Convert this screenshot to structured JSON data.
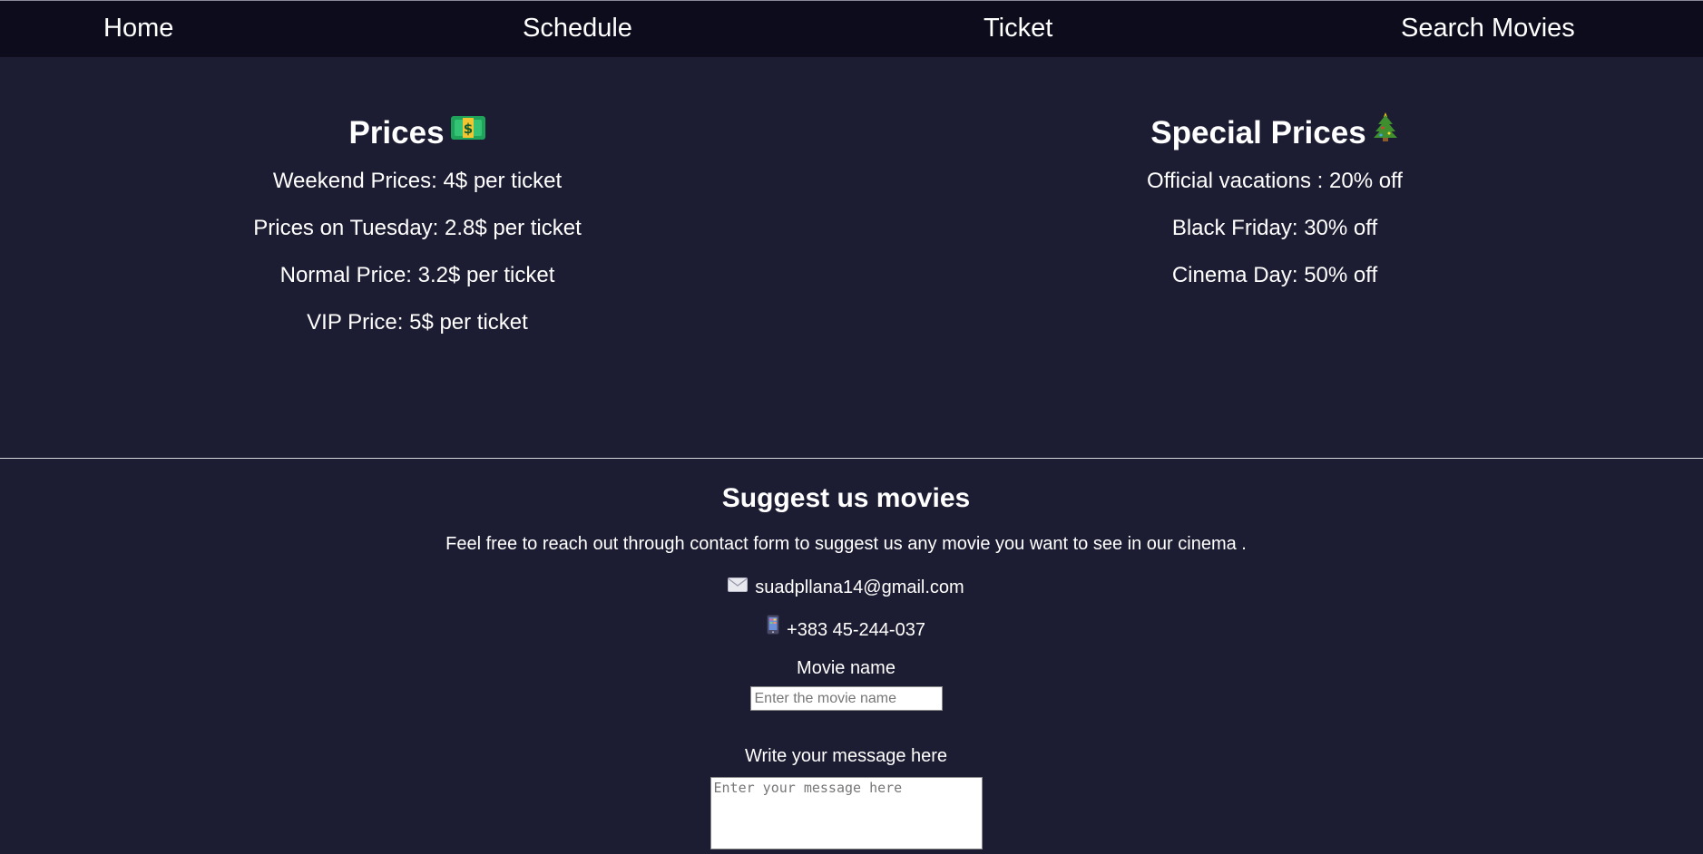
{
  "nav": {
    "items": [
      "Home",
      "Schedule",
      "Ticket",
      "Search Movies"
    ]
  },
  "prices": {
    "title": "Prices",
    "icon": "money-banknote-icon",
    "lines": [
      "Weekend Prices: 4$ per ticket",
      "Prices on Tuesday: 2.8$ per ticket",
      "Normal Price: 3.2$ per ticket",
      "VIP Price: 5$ per ticket"
    ]
  },
  "special": {
    "title": "Special Prices",
    "icon": "christmas-tree-icon",
    "lines": [
      "Official vacations : 20% off",
      "Black Friday: 30% off",
      "Cinema Day: 50% off"
    ]
  },
  "suggest": {
    "title": "Suggest us movies",
    "description": "Feel free to reach out through contact form to suggest us any movie you want to see in our cinema .",
    "email": "suadpllana14@gmail.com",
    "email_icon": "envelope-icon",
    "phone": "+383 45-244-037",
    "phone_icon": "mobile-phone-icon",
    "movie_label": "Movie name",
    "movie_placeholder": "Enter the movie name",
    "message_label": "Write your message here",
    "message_placeholder": "Enter your message here"
  },
  "colors": {
    "background": "#1c1c33",
    "navbar": "#0c0c1c",
    "text": "#ffffff"
  }
}
